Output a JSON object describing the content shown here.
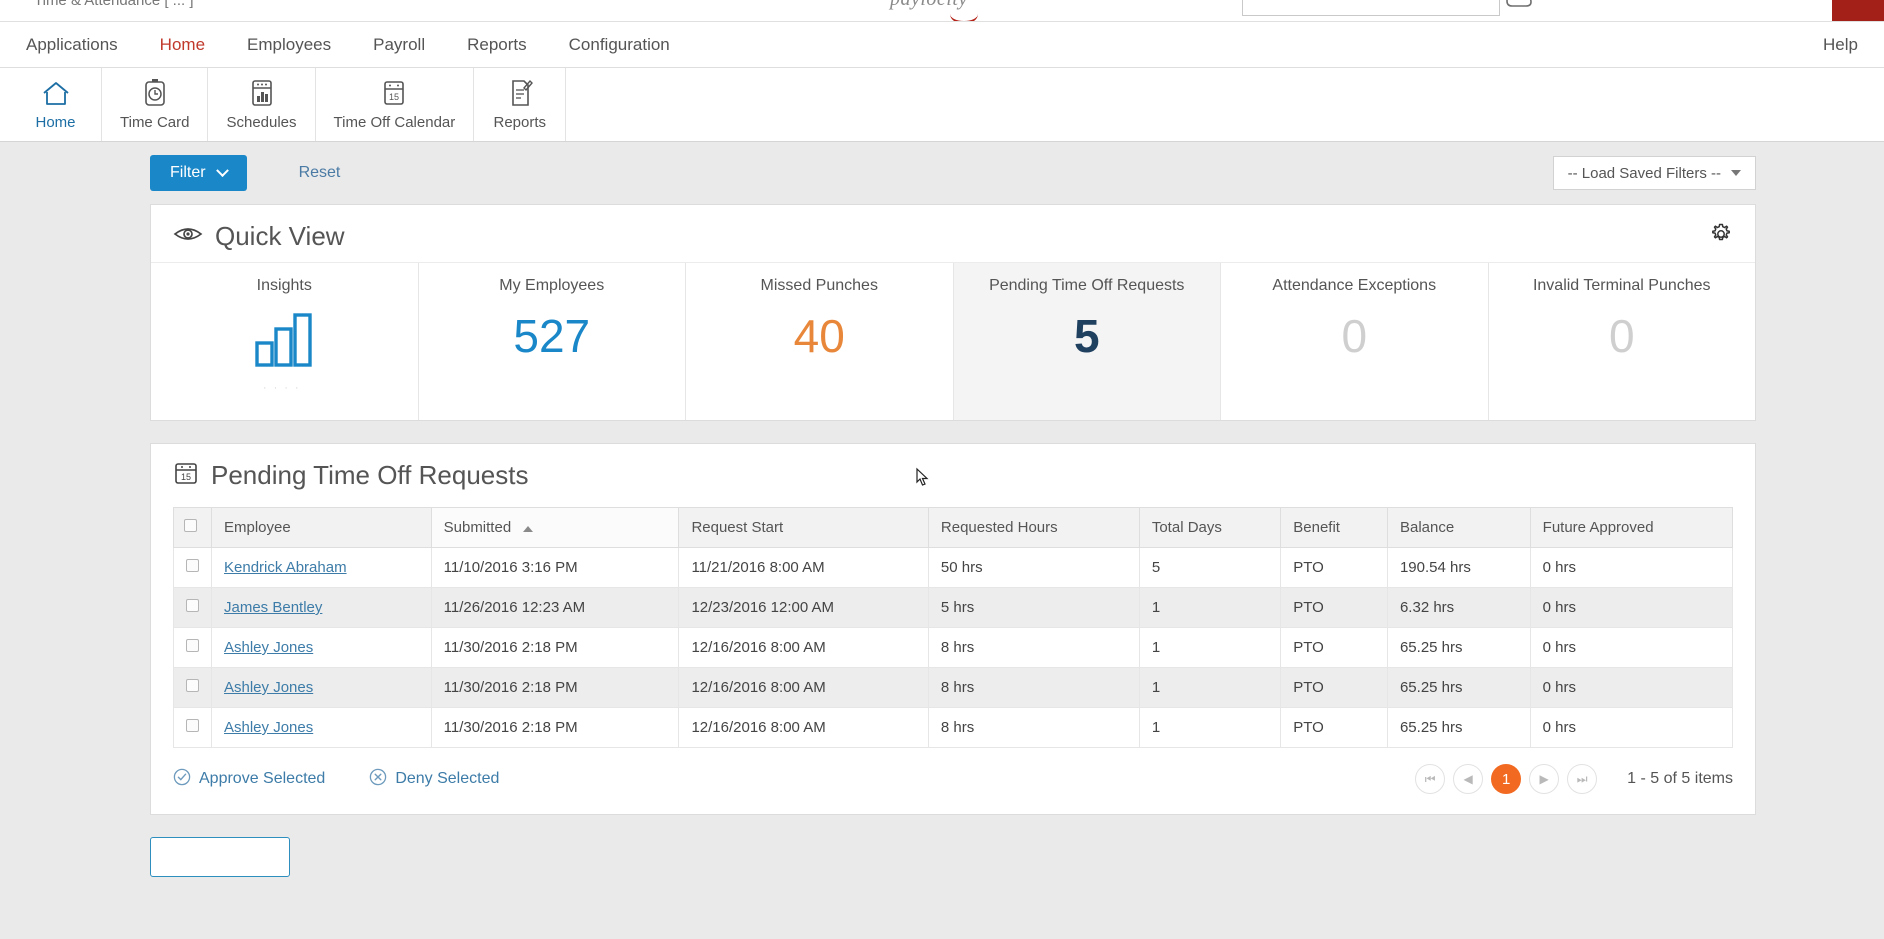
{
  "browser_chrome": {
    "window_title": "Time & Attendance [ ... ]",
    "brand": "paylocity",
    "search_placeholder": "",
    "search_value": ""
  },
  "menubar": {
    "items": [
      {
        "label": "Applications",
        "active": false
      },
      {
        "label": "Home",
        "active": true
      },
      {
        "label": "Employees",
        "active": false
      },
      {
        "label": "Payroll",
        "active": false
      },
      {
        "label": "Reports",
        "active": false
      },
      {
        "label": "Configuration",
        "active": false
      }
    ],
    "help_label": "Help"
  },
  "toolbar": {
    "items": [
      {
        "label": "Home",
        "icon": "home-icon",
        "active": true
      },
      {
        "label": "Time Card",
        "icon": "stopwatch-icon",
        "active": false
      },
      {
        "label": "Schedules",
        "icon": "schedule-chart-icon",
        "active": false
      },
      {
        "label": "Time Off Calendar",
        "icon": "calendar-icon",
        "active": false
      },
      {
        "label": "Reports",
        "icon": "report-pencil-icon",
        "active": false
      }
    ]
  },
  "filter_bar": {
    "filter_label": "Filter",
    "reset_label": "Reset",
    "saved_filters_label": "-- Load Saved Filters --"
  },
  "quick_view": {
    "title": "Quick View",
    "icon": "eye-icon",
    "settings_icon": "gear-icon",
    "tiles": [
      {
        "label": "Insights",
        "value": "",
        "kind": "chart",
        "color": "#1a87c8",
        "hovered": false
      },
      {
        "label": "My Employees",
        "value": "527",
        "kind": "number",
        "color": "#1a87c8",
        "hovered": false
      },
      {
        "label": "Missed Punches",
        "value": "40",
        "kind": "number",
        "color": "#e8873a",
        "hovered": false
      },
      {
        "label": "Pending Time Off Requests",
        "value": "5",
        "kind": "number",
        "color": "#204060",
        "hovered": true
      },
      {
        "label": "Attendance Exceptions",
        "value": "0",
        "kind": "number",
        "color": "#cfcfcf",
        "hovered": false
      },
      {
        "label": "Invalid Terminal Punches",
        "value": "0",
        "kind": "number",
        "color": "#cfcfcf",
        "hovered": false
      }
    ]
  },
  "pending_requests": {
    "title": "Pending Time Off Requests",
    "icon": "calendar-15-icon",
    "columns": [
      "Employee",
      "Submitted",
      "Request Start",
      "Requested Hours",
      "Total Days",
      "Benefit",
      "Balance",
      "Future Approved"
    ],
    "sort": {
      "column": "Submitted",
      "direction": "asc"
    },
    "rows": [
      {
        "employee": "Kendrick Abraham",
        "submitted": "11/10/2016 3:16 PM",
        "request_start": "11/21/2016 8:00 AM",
        "requested_hours": "50 hrs",
        "total_days": "5",
        "benefit": "PTO",
        "balance": "190.54 hrs",
        "future_approved": "0 hrs"
      },
      {
        "employee": "James Bentley",
        "submitted": "11/26/2016 12:23 AM",
        "request_start": "12/23/2016 12:00 AM",
        "requested_hours": "5 hrs",
        "total_days": "1",
        "benefit": "PTO",
        "balance": "6.32 hrs",
        "future_approved": "0 hrs"
      },
      {
        "employee": "Ashley Jones",
        "submitted": "11/30/2016 2:18 PM",
        "request_start": "12/16/2016 8:00 AM",
        "requested_hours": "8 hrs",
        "total_days": "1",
        "benefit": "PTO",
        "balance": "65.25 hrs",
        "future_approved": "0 hrs"
      },
      {
        "employee": "Ashley Jones",
        "submitted": "11/30/2016 2:18 PM",
        "request_start": "12/16/2016 8:00 AM",
        "requested_hours": "8 hrs",
        "total_days": "1",
        "benefit": "PTO",
        "balance": "65.25 hrs",
        "future_approved": "0 hrs"
      },
      {
        "employee": "Ashley Jones",
        "submitted": "11/30/2016 2:18 PM",
        "request_start": "12/16/2016 8:00 AM",
        "requested_hours": "8 hrs",
        "total_days": "1",
        "benefit": "PTO",
        "balance": "65.25 hrs",
        "future_approved": "0 hrs"
      }
    ],
    "footer": {
      "approve_label": "Approve Selected",
      "deny_label": "Deny Selected",
      "pager": {
        "first": "first-page-icon",
        "prev": "previous-page-icon",
        "current_page": "1",
        "next": "next-page-icon",
        "last": "last-page-icon",
        "info": "1 - 5 of 5 items"
      }
    }
  },
  "colors": {
    "accent_blue": "#1a87c8",
    "accent_orange": "#f26a21",
    "link_blue": "#3d7ca8",
    "active_menu_red": "#c0392b",
    "page_bg": "#eaeaea"
  }
}
